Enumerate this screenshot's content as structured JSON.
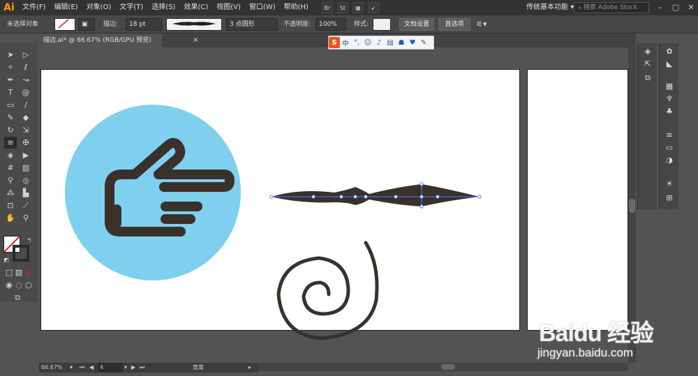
{
  "app": {
    "logo": "Ai"
  },
  "menu": [
    "文件(F)",
    "编辑(E)",
    "对象(O)",
    "文字(T)",
    "选择(S)",
    "效果(C)",
    "视图(V)",
    "窗口(W)",
    "帮助(H)"
  ],
  "menu_icons": {
    "bridge": "Br",
    "stock": "St"
  },
  "workspace": {
    "label": "传统基本功能"
  },
  "search": {
    "placeholder": "搜索 Adobe Stock"
  },
  "control": {
    "selection": "未选择对象",
    "stroke_label": "描边:",
    "stroke_value": "18 pt",
    "brush_label": "3 点圆形",
    "opacity_label": "不透明度:",
    "opacity_value": "100%",
    "style_label": "样式:",
    "doc_settings": "文档设置",
    "preferences": "首选项"
  },
  "tab": {
    "title": "描边.ai* @ 66.67% (RGB/GPU 预览)",
    "close": "×"
  },
  "ime": {
    "lang": "中"
  },
  "status": {
    "zoom": "66.67%",
    "page": "4",
    "tool": "宽度"
  },
  "watermark": {
    "text": "Bai",
    "text2": "经验",
    "url": "jingyan.baidu.com"
  },
  "colors": {
    "circle": "#7fd0ef",
    "shape": "#3a312b",
    "accent": "#ff9a00"
  },
  "icons": {
    "artwork": [
      "hand-pointing-icon",
      "width-stroke-shape",
      "spiral-shape"
    ]
  }
}
